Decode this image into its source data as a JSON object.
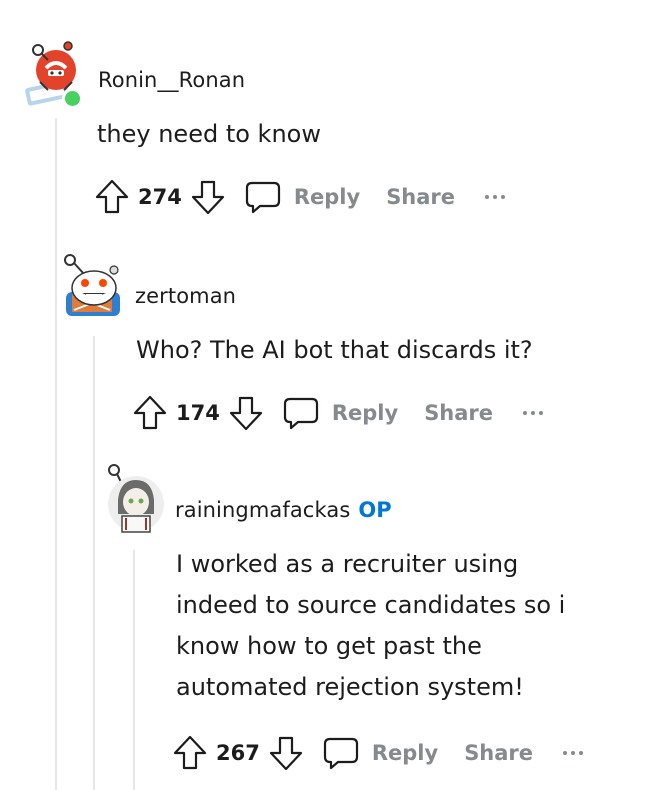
{
  "comments": [
    {
      "username": "Ronin__Ronan",
      "body": "they need to know",
      "score": "274",
      "reply_label": "Reply",
      "share_label": "Share",
      "more_label": "...",
      "online": true,
      "avatar_color": "#e3432b"
    },
    {
      "username": "zertoman",
      "body": "Who? The AI bot that discards it?",
      "score": "174",
      "reply_label": "Reply",
      "share_label": "Share",
      "more_label": "..."
    },
    {
      "username": "rainingmafackas",
      "op_badge": "OP",
      "body_lines": [
        "I worked as a recruiter using",
        "indeed to source candidates so i",
        "know how to get past the",
        "automated rejection system!"
      ],
      "score": "267",
      "reply_label": "Reply",
      "share_label": "Share",
      "more_label": "..."
    }
  ],
  "colors": {
    "text": "#1c1c1c",
    "muted": "#878a8c",
    "op": "#0079d3",
    "thread_line": "#e8e8e8",
    "online": "#46d160"
  },
  "icons": [
    "upvote-icon",
    "downvote-icon",
    "comment-icon",
    "more-icon"
  ]
}
